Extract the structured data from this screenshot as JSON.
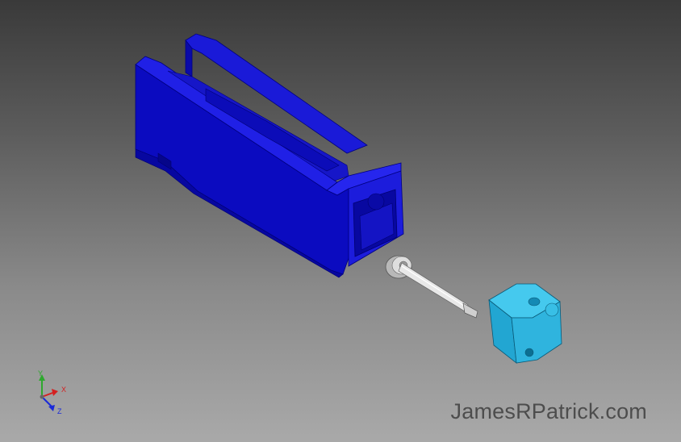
{
  "viewport": {
    "background_top": "#3a3a3a",
    "background_bottom": "#a9a9a9"
  },
  "model": {
    "parts": [
      {
        "name": "housing",
        "color": "#1010d0"
      },
      {
        "name": "washer",
        "color": "#d8d8d8"
      },
      {
        "name": "pin",
        "color": "#e6e6e6"
      },
      {
        "name": "end-cap",
        "color": "#2ab6e0"
      }
    ]
  },
  "triad": {
    "y_label": "Y",
    "x_label": "X",
    "z_label": "Z",
    "y_color": "#2ea82e",
    "x_color": "#d42020",
    "z_color": "#1a2ad8"
  },
  "watermark": {
    "text": "JamesRPatrick.com"
  }
}
